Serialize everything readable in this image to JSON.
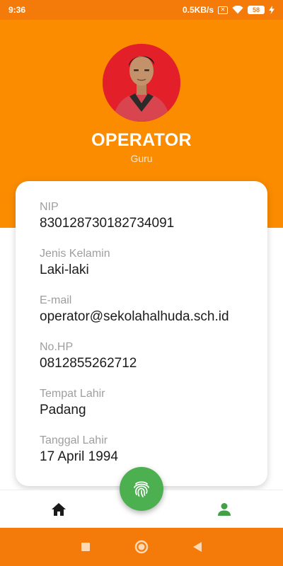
{
  "status_bar": {
    "time": "9:36",
    "network_speed": "0.5KB/s",
    "battery": "58"
  },
  "profile": {
    "name": "OPERATOR",
    "role": "Guru"
  },
  "fields": [
    {
      "label": "NIP",
      "value": "830128730182734091"
    },
    {
      "label": "Jenis Kelamin",
      "value": "Laki-laki"
    },
    {
      "label": "E-mail",
      "value": "operator@sekolahalhuda.sch.id"
    },
    {
      "label": "No.HP",
      "value": "0812855262712"
    },
    {
      "label": "Tempat Lahir",
      "value": "Padang"
    },
    {
      "label": "Tanggal Lahir",
      "value": "17 April 1994"
    }
  ],
  "bottom_nav": {
    "home_icon": "home-icon",
    "fab_icon": "fingerprint-icon",
    "profile_icon": "person-icon",
    "active": "profile"
  },
  "colors": {
    "header": "#fb8c00",
    "status_bar": "#f47b0a",
    "fab": "#4caf50",
    "active_nav": "#43a047"
  }
}
